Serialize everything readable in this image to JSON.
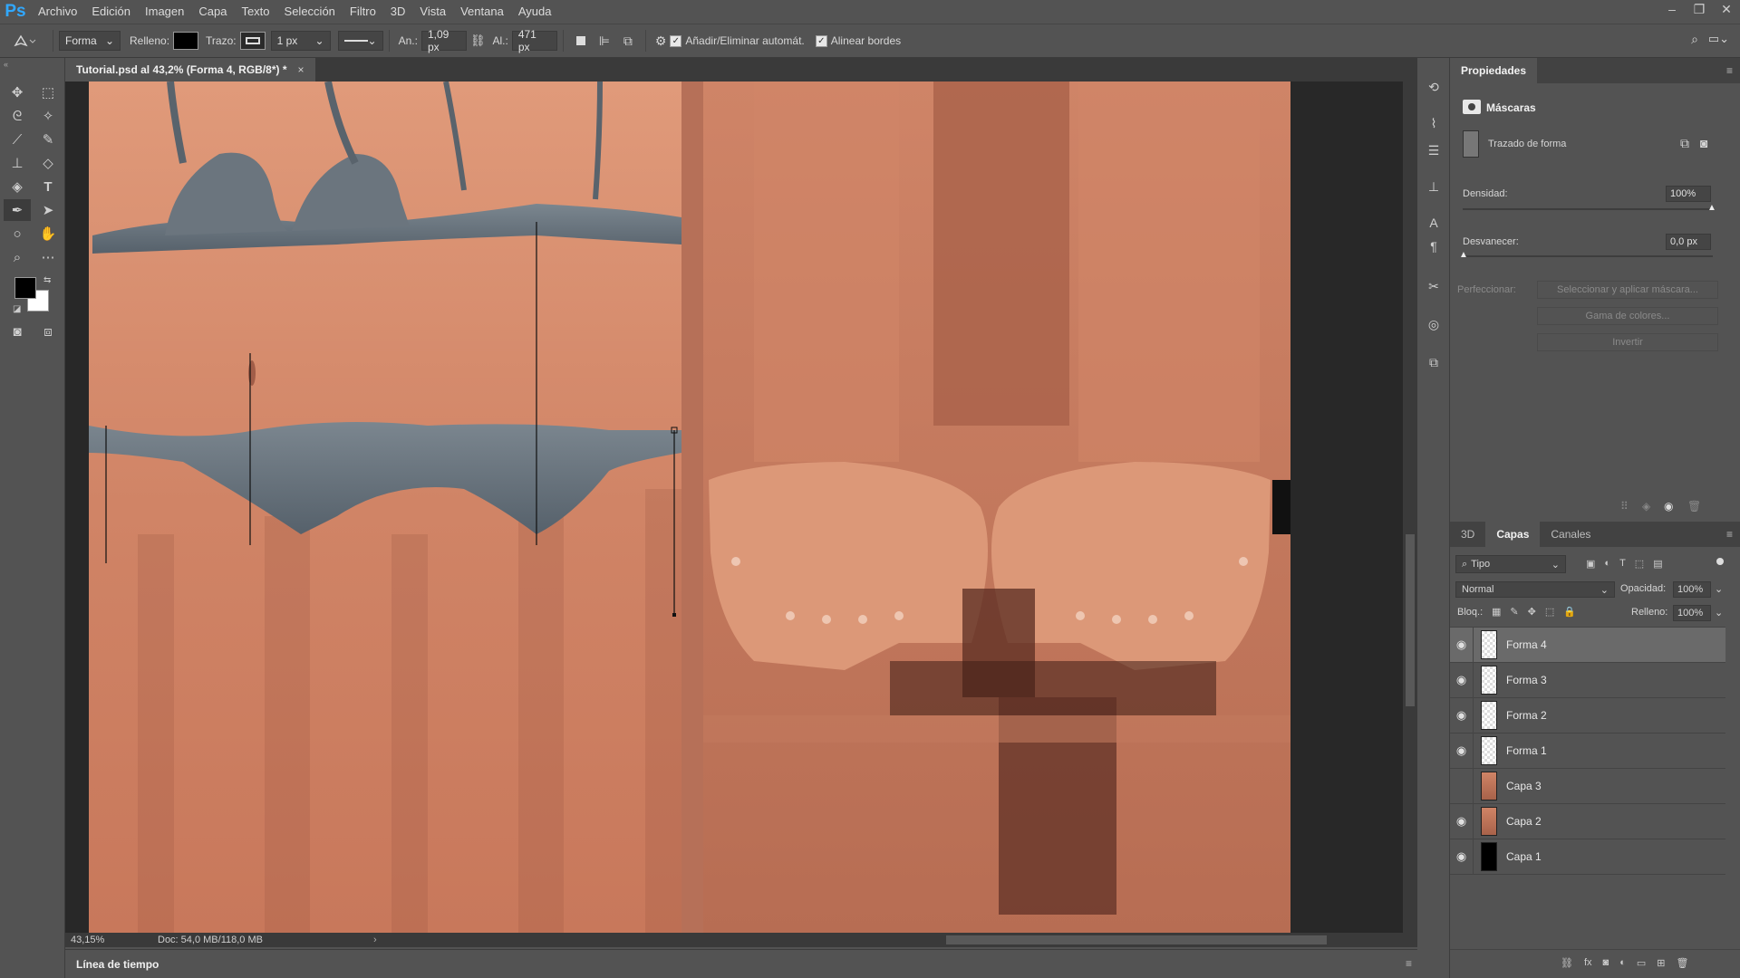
{
  "app": {
    "logo": "Ps"
  },
  "menu": [
    "Archivo",
    "Edición",
    "Imagen",
    "Capa",
    "Texto",
    "Selección",
    "Filtro",
    "3D",
    "Vista",
    "Ventana",
    "Ayuda"
  ],
  "window_controls": [
    "–",
    "❐",
    "✕"
  ],
  "options_bar": {
    "mode": "Forma",
    "fill_label": "Relleno:",
    "stroke_label": "Trazo:",
    "stroke_width": "1 px",
    "width_label": "An.:",
    "width_value": "1,09 px",
    "height_label": "Al.:",
    "height_value": "471 px",
    "auto_add_delete": "Añadir/Eliminar automát.",
    "align_edges": "Alinear bordes"
  },
  "document": {
    "tab_title": "Tutorial.psd al 43,2% (Forma 4, RGB/8*) *",
    "close": "×",
    "zoom": "43,15%",
    "doc_info": "Doc: 54,0 MB/118,0 MB"
  },
  "timeline": {
    "label": "Línea de tiempo"
  },
  "properties": {
    "tab": "Propiedades",
    "section": "Máscaras",
    "subtitle": "Trazado de forma",
    "density_label": "Densidad:",
    "density_value": "100%",
    "feather_label": "Desvanecer:",
    "feather_value": "0,0 px",
    "refine_label": "Perfeccionar:",
    "btn_select_mask": "Seleccionar y aplicar máscara...",
    "btn_color_range": "Gama de colores...",
    "btn_invert": "Invertir"
  },
  "layers_panel": {
    "tabs": [
      "3D",
      "Capas",
      "Canales"
    ],
    "active_tab": "Capas",
    "filter": "Tipo",
    "blend_mode": "Normal",
    "opacity_label": "Opacidad:",
    "opacity_value": "100%",
    "lock_label": "Bloq.:",
    "fill_label": "Relleno:",
    "fill_value": "100%",
    "layers": [
      {
        "name": "Forma 4",
        "visible": true,
        "selected": true,
        "kind": "shape"
      },
      {
        "name": "Forma 3",
        "visible": true,
        "selected": false,
        "kind": "shape"
      },
      {
        "name": "Forma 2",
        "visible": true,
        "selected": false,
        "kind": "shape"
      },
      {
        "name": "Forma 1",
        "visible": true,
        "selected": false,
        "kind": "shape"
      },
      {
        "name": "Capa 3",
        "visible": false,
        "selected": false,
        "kind": "image"
      },
      {
        "name": "Capa 2",
        "visible": true,
        "selected": false,
        "kind": "image"
      },
      {
        "name": "Capa 1",
        "visible": true,
        "selected": false,
        "kind": "black"
      }
    ]
  },
  "colors": {
    "accent": "#31a8ff",
    "panel": "#535353",
    "dark": "#3a3a3a",
    "skin": "#c98467"
  }
}
